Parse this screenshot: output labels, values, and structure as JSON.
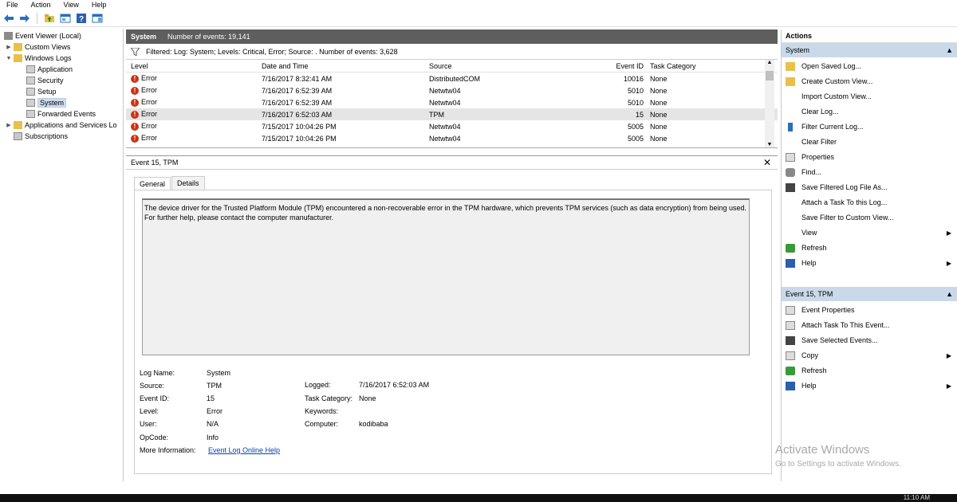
{
  "menu": [
    "File",
    "Action",
    "View",
    "Help"
  ],
  "tree": {
    "root": "Event Viewer (Local)",
    "custom_views": "Custom Views",
    "windows_logs": "Windows Logs",
    "logs": [
      "Application",
      "Security",
      "Setup",
      "System",
      "Forwarded Events"
    ],
    "apps_services": "Applications and Services Lo",
    "subscriptions": "Subscriptions"
  },
  "header": {
    "title": "System",
    "count": "Number of events: 19,141"
  },
  "filter": "Filtered: Log: System; Levels: Critical, Error; Source: . Number of events: 3,628",
  "columns": [
    "Level",
    "Date and Time",
    "Source",
    "Event ID",
    "Task Category"
  ],
  "rows": [
    [
      "Error",
      "7/16/2017 8:32:41 AM",
      "DistributedCOM",
      "10016",
      "None"
    ],
    [
      "Error",
      "7/16/2017 6:52:39 AM",
      "Netwtw04",
      "5010",
      "None"
    ],
    [
      "Error",
      "7/16/2017 6:52:39 AM",
      "Netwtw04",
      "5010",
      "None"
    ],
    [
      "Error",
      "7/16/2017 6:52:03 AM",
      "TPM",
      "15",
      "None"
    ],
    [
      "Error",
      "7/15/2017 10:04:26 PM",
      "Netwtw04",
      "5005",
      "None"
    ],
    [
      "Error",
      "7/15/2017 10:04:26 PM",
      "Netwtw04",
      "5005",
      "None"
    ]
  ],
  "detail": {
    "title": "Event 15, TPM",
    "tabs": [
      "General",
      "Details"
    ],
    "description": "The device driver for the Trusted Platform Module (TPM) encountered a non-recoverable error in the TPM hardware, which prevents TPM services (such as data encryption) from being used. For further help, please contact the computer manufacturer.",
    "labels": {
      "log_name": "Log Name:",
      "source": "Source:",
      "event_id": "Event ID:",
      "level": "Level:",
      "user": "User:",
      "opcode": "OpCode:",
      "more_info": "More Information:",
      "logged": "Logged:",
      "task_category": "Task Category:",
      "keywords": "Keywords:",
      "computer": "Computer:"
    },
    "values": {
      "log_name": "System",
      "source": "TPM",
      "event_id": "15",
      "level": "Error",
      "user": "N/A",
      "opcode": "Info",
      "more_info": "Event Log Online Help",
      "logged": "7/16/2017 6:52:03 AM",
      "task_category": "None",
      "keywords": "",
      "computer": "kodibaba"
    }
  },
  "actions": {
    "title": "Actions",
    "section1": "System",
    "items1": [
      "Open Saved Log...",
      "Create Custom View...",
      "Import Custom View...",
      "Clear Log...",
      "Filter Current Log...",
      "Clear Filter",
      "Properties",
      "Find...",
      "Save Filtered Log File As...",
      "Attach a Task To this Log...",
      "Save Filter to Custom View...",
      "View",
      "Refresh",
      "Help"
    ],
    "section2": "Event 15, TPM",
    "items2": [
      "Event Properties",
      "Attach Task To This Event...",
      "Save Selected Events...",
      "Copy",
      "Refresh",
      "Help"
    ]
  },
  "watermark": {
    "line1": "Activate Windows",
    "line2": "Go to Settings to activate Windows."
  },
  "taskbar_time": "11:10 AM",
  "colors": {
    "header_bar": "#5e5e5e",
    "section_bg": "#c9d9ea",
    "error_red": "#cc3311",
    "link": "#0645ad"
  }
}
